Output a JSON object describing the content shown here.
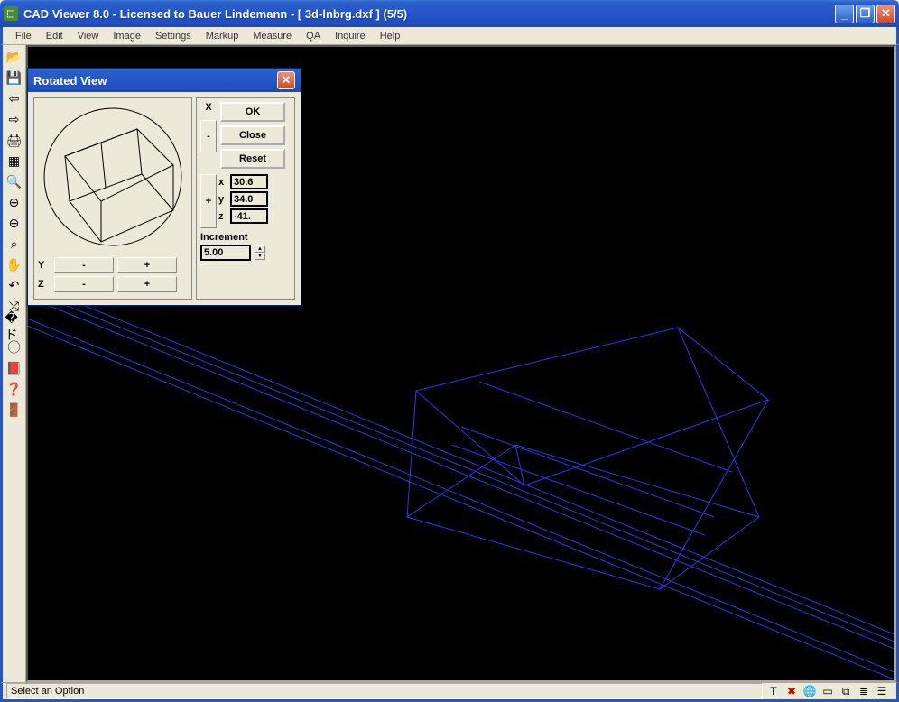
{
  "window": {
    "title": "CAD Viewer 8.0 - Licensed to Bauer Lindemann  -  [ 3d-lnbrg.dxf ] (5/5)"
  },
  "menubar": {
    "items": [
      "File",
      "Edit",
      "View",
      "Image",
      "Settings",
      "Markup",
      "Measure",
      "QA",
      "Inquire",
      "Help"
    ]
  },
  "toolbar": {
    "items": [
      {
        "name": "open-icon",
        "glyph": "📂"
      },
      {
        "name": "save-icon",
        "glyph": "💾"
      },
      {
        "name": "arrow-left-icon",
        "glyph": "⇦"
      },
      {
        "name": "arrow-right-icon",
        "glyph": "⇨"
      },
      {
        "name": "print-icon",
        "glyph": "🖨"
      },
      {
        "name": "layers-icon",
        "glyph": "▦"
      },
      {
        "name": "zoom-fit-icon",
        "glyph": "🔍"
      },
      {
        "name": "zoom-in-icon",
        "glyph": "⊕"
      },
      {
        "name": "zoom-out-icon",
        "glyph": "⊖"
      },
      {
        "name": "zoom-window-icon",
        "glyph": "⌕"
      },
      {
        "name": "pan-icon",
        "glyph": "✋"
      },
      {
        "name": "undo-icon",
        "glyph": "↶"
      },
      {
        "name": "rotate-3d-icon",
        "glyph": "⤮"
      },
      {
        "name": "measure-icon",
        "glyph": "�ド"
      },
      {
        "name": "info-icon",
        "glyph": "ⓘ"
      },
      {
        "name": "help-book-icon",
        "glyph": "📕"
      },
      {
        "name": "context-help-icon",
        "glyph": "❓"
      },
      {
        "name": "exit-icon",
        "glyph": "🚪"
      }
    ]
  },
  "dialog": {
    "title": "Rotated View",
    "ok_label": "OK",
    "close_label": "Close",
    "reset_label": "Reset",
    "x_label": "X",
    "y_label": "Y",
    "z_label": "Z",
    "x_value": "30.6",
    "y_value": "34.0",
    "z_value": "-41.",
    "increment_label": "Increment",
    "increment_value": "5.00",
    "minus": "-",
    "plus": "+"
  },
  "statusbar": {
    "text": "Select an Option"
  }
}
